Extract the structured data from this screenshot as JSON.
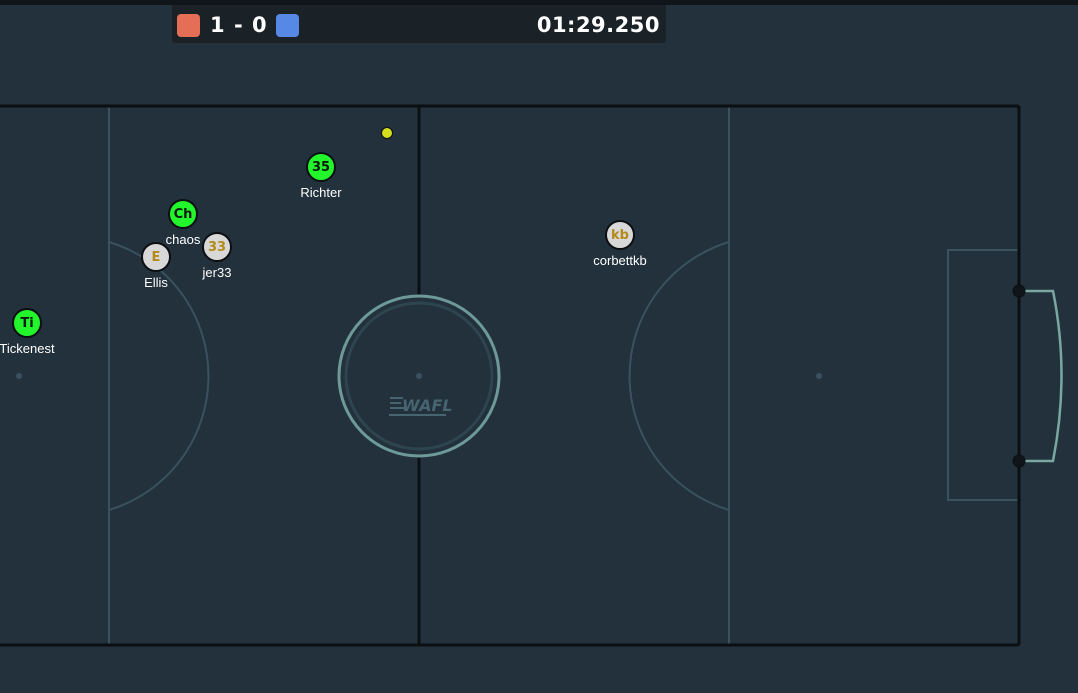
{
  "scoreboard": {
    "red_score": "1",
    "separator": "-",
    "blue_score": "0",
    "timer": "01:29.250",
    "red_color": "#e56e56",
    "blue_color": "#5689e5"
  },
  "field": {
    "logo_text": "WAFL",
    "line_color": "#0b0f12",
    "marking_color": "#3a525e",
    "goal_color": "#78a8a0"
  },
  "players": [
    {
      "badge": "35",
      "name": "Richter",
      "team": "green"
    },
    {
      "badge": "Ch",
      "name": "chaos",
      "team": "green"
    },
    {
      "badge": "33",
      "name": "jer33",
      "team": "grey"
    },
    {
      "badge": "E",
      "name": "Ellis",
      "team": "grey"
    },
    {
      "badge": "Ti",
      "name": "Tickenest",
      "team": "green"
    },
    {
      "badge": "kb",
      "name": "corbettkb",
      "team": "grey"
    }
  ]
}
